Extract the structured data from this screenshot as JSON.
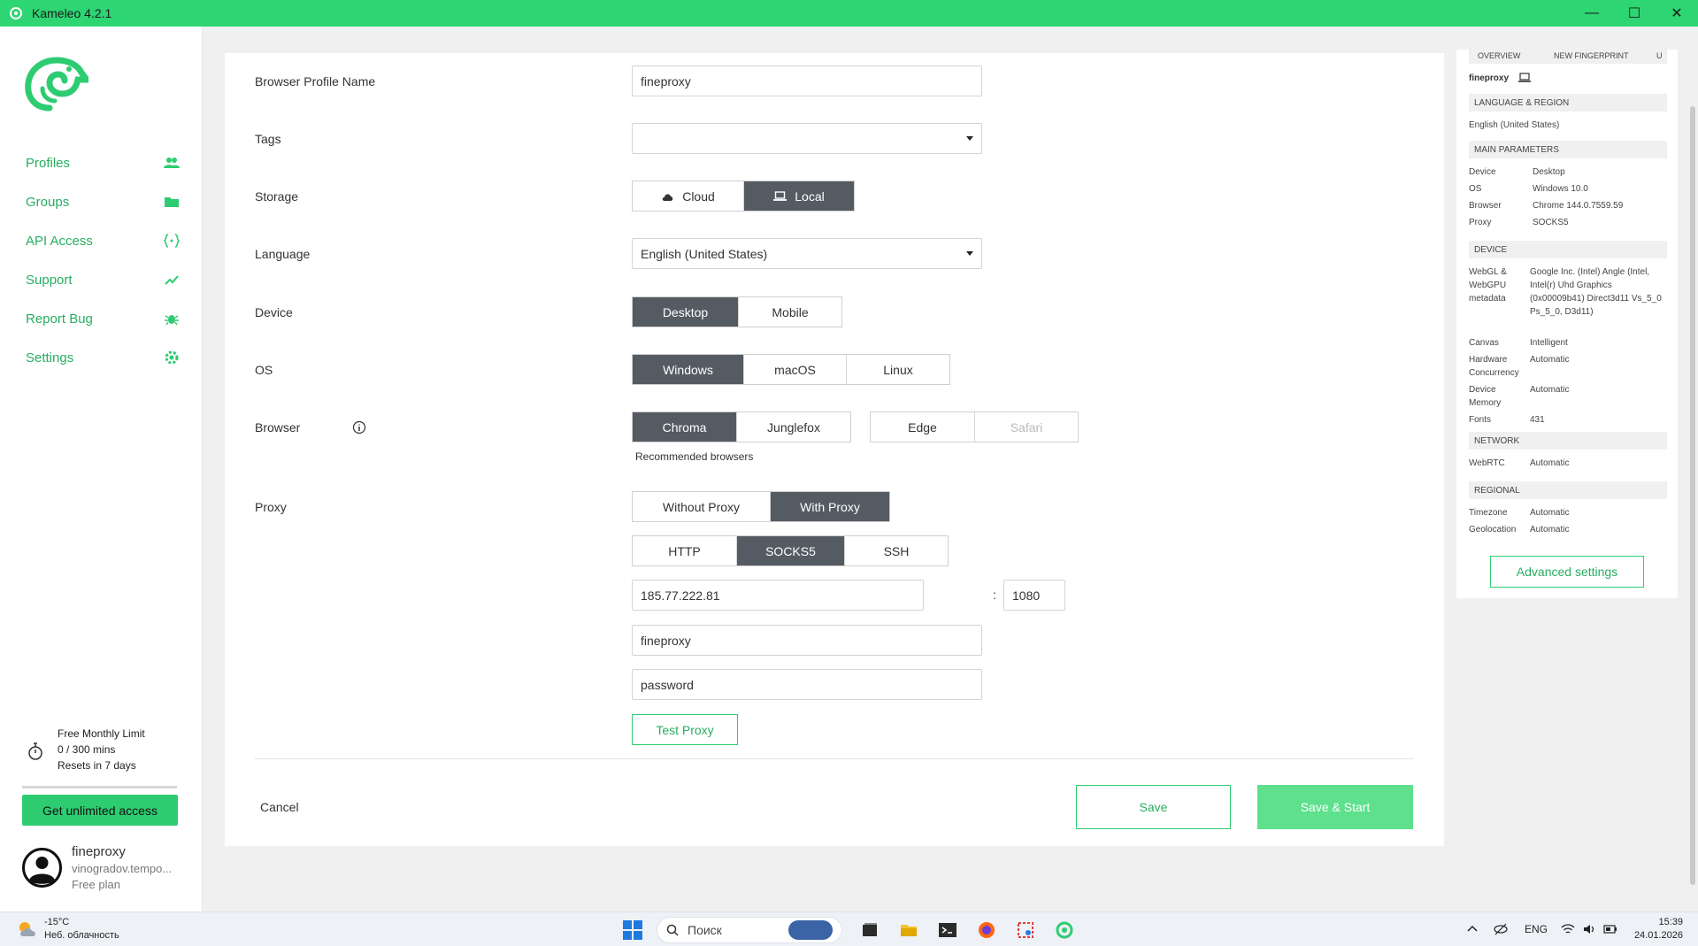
{
  "window": {
    "title": "Kameleo 4.2.1",
    "minimize": "—",
    "maximize": "☐",
    "close": "✕"
  },
  "sidebar": {
    "items": [
      {
        "label": "Profiles",
        "icon": "users-icon"
      },
      {
        "label": "Groups",
        "icon": "folder-icon"
      },
      {
        "label": "API Access",
        "icon": "api-icon"
      },
      {
        "label": "Support",
        "icon": "chart-icon"
      },
      {
        "label": "Report Bug",
        "icon": "bug-icon"
      },
      {
        "label": "Settings",
        "icon": "gear-icon"
      }
    ],
    "limit": {
      "title": "Free Monthly Limit",
      "usage": "0 / 300 mins",
      "reset": "Resets in 7 days",
      "used_fraction": 0
    },
    "unlimited_button": "Get unlimited access",
    "user": {
      "name": "fineproxy",
      "email": "vinogradov.tempo...",
      "plan": "Free plan"
    }
  },
  "form": {
    "profile_name": {
      "label": "Browser Profile Name",
      "value": "fineproxy"
    },
    "tags": {
      "label": "Tags",
      "value": ""
    },
    "storage": {
      "label": "Storage",
      "options": [
        "Cloud",
        "Local"
      ],
      "selected": "Local"
    },
    "language": {
      "label": "Language",
      "value": "English (United States)"
    },
    "device": {
      "label": "Device",
      "options": [
        "Desktop",
        "Mobile"
      ],
      "selected": "Desktop"
    },
    "os": {
      "label": "OS",
      "options": [
        "Windows",
        "macOS",
        "Linux"
      ],
      "selected": "Windows"
    },
    "browser": {
      "label": "Browser",
      "recommended": [
        "Chroma",
        "Junglefox"
      ],
      "others": [
        "Edge",
        "Safari"
      ],
      "selected": "Chroma",
      "note": "Recommended browsers"
    },
    "proxy": {
      "label": "Proxy",
      "mode_options": [
        "Without Proxy",
        "With Proxy"
      ],
      "mode_selected": "With Proxy",
      "type_options": [
        "HTTP",
        "SOCKS5",
        "SSH"
      ],
      "type_selected": "SOCKS5",
      "host": "185.77.222.81",
      "separator": ":",
      "port": "1080",
      "username": "fineproxy",
      "password": "password",
      "test_button": "Test Proxy"
    },
    "cancel": "Cancel",
    "save": "Save",
    "save_start": "Save & Start"
  },
  "overview": {
    "tabs": [
      "OVERVIEW",
      "NEW FINGERPRINT",
      "U"
    ],
    "profile_name": "fineproxy",
    "language_region_header": "LANGUAGE & REGION",
    "language_value": "English (United States)",
    "main_params_header": "MAIN PARAMETERS",
    "main_params": [
      {
        "key": "Device",
        "value": "Desktop"
      },
      {
        "key": "OS",
        "value": "Windows 10.0"
      },
      {
        "key": "Browser",
        "value": "Chrome 144.0.7559.59"
      },
      {
        "key": "Proxy",
        "value": "SOCKS5"
      }
    ],
    "device_header": "DEVICE",
    "device_params": [
      {
        "key": "WebGL & WebGPU metadata",
        "value": "Google Inc. (Intel) Angle (Intel, Intel(r) Uhd Graphics (0x00009b41) Direct3d11 Vs_5_0 Ps_5_0, D3d11)"
      },
      {
        "key": "Canvas",
        "value": "Intelligent"
      },
      {
        "key": "Hardware Concurrency",
        "value": "Automatic"
      },
      {
        "key": "Device Memory",
        "value": "Automatic"
      },
      {
        "key": "Fonts",
        "value": "431"
      }
    ],
    "network_header": "NETWORK",
    "network_params": [
      {
        "key": "WebRTC",
        "value": "Automatic"
      }
    ],
    "regional_header": "REGIONAL",
    "regional_params": [
      {
        "key": "Timezone",
        "value": "Automatic"
      },
      {
        "key": "Geolocation",
        "value": "Automatic"
      }
    ],
    "advanced_button": "Advanced settings"
  },
  "taskbar": {
    "weather_temp": "-15°C",
    "weather_desc": "Неб. облачность",
    "search_placeholder": "Поиск",
    "language": "ENG",
    "time": "15:39",
    "date": "24.01.2026"
  },
  "colors": {
    "accent": "#2ecc71",
    "titlebar": "#2ed573",
    "active_segment": "#555b63"
  }
}
